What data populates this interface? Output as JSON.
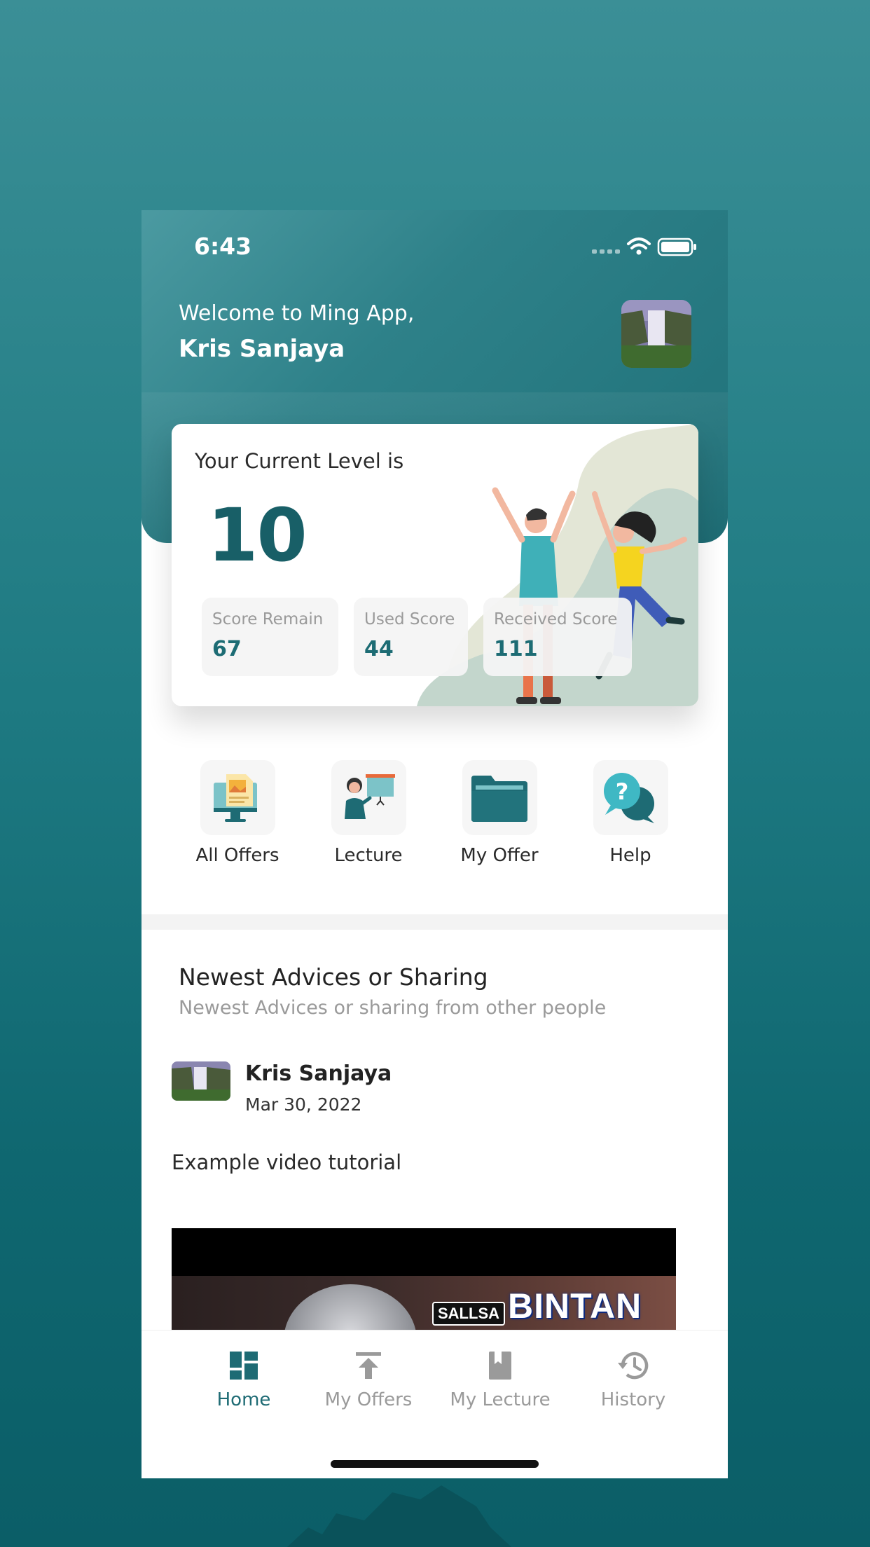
{
  "status_bar": {
    "time": "6:43"
  },
  "header": {
    "welcome": "Welcome to Ming App,",
    "username": "Kris Sanjaya"
  },
  "level_card": {
    "label": "Your Current Level is",
    "level": "10",
    "scores": [
      {
        "label": "Score Remain",
        "value": "67"
      },
      {
        "label": "Used Score",
        "value": "44"
      },
      {
        "label": "Received Score",
        "value": "111"
      }
    ]
  },
  "menu": [
    {
      "label": "All Offers",
      "icon": "monitor-image-icon"
    },
    {
      "label": "Lecture",
      "icon": "presenter-icon"
    },
    {
      "label": "My Offer",
      "icon": "folder-icon"
    },
    {
      "label": "Help",
      "icon": "help-chat-icon"
    }
  ],
  "section": {
    "title": "Newest Advices or Sharing",
    "subtitle": "Newest Advices or sharing from other people"
  },
  "post": {
    "author": "Kris Sanjaya",
    "date": "Mar 30, 2022",
    "text": "Example video tutorial",
    "video_overlay": {
      "small": "SALLSA",
      "big": "BINTAN"
    }
  },
  "tabs": [
    {
      "label": "Home",
      "icon": "dashboard-icon",
      "active": true
    },
    {
      "label": "My Offers",
      "icon": "upload-icon",
      "active": false
    },
    {
      "label": "My Lecture",
      "icon": "book-icon",
      "active": false
    },
    {
      "label": "History",
      "icon": "history-icon",
      "active": false
    }
  ],
  "colors": {
    "primary": "#1e6b74",
    "accent_light": "#3b8f96",
    "inactive": "#9a9a9a"
  }
}
